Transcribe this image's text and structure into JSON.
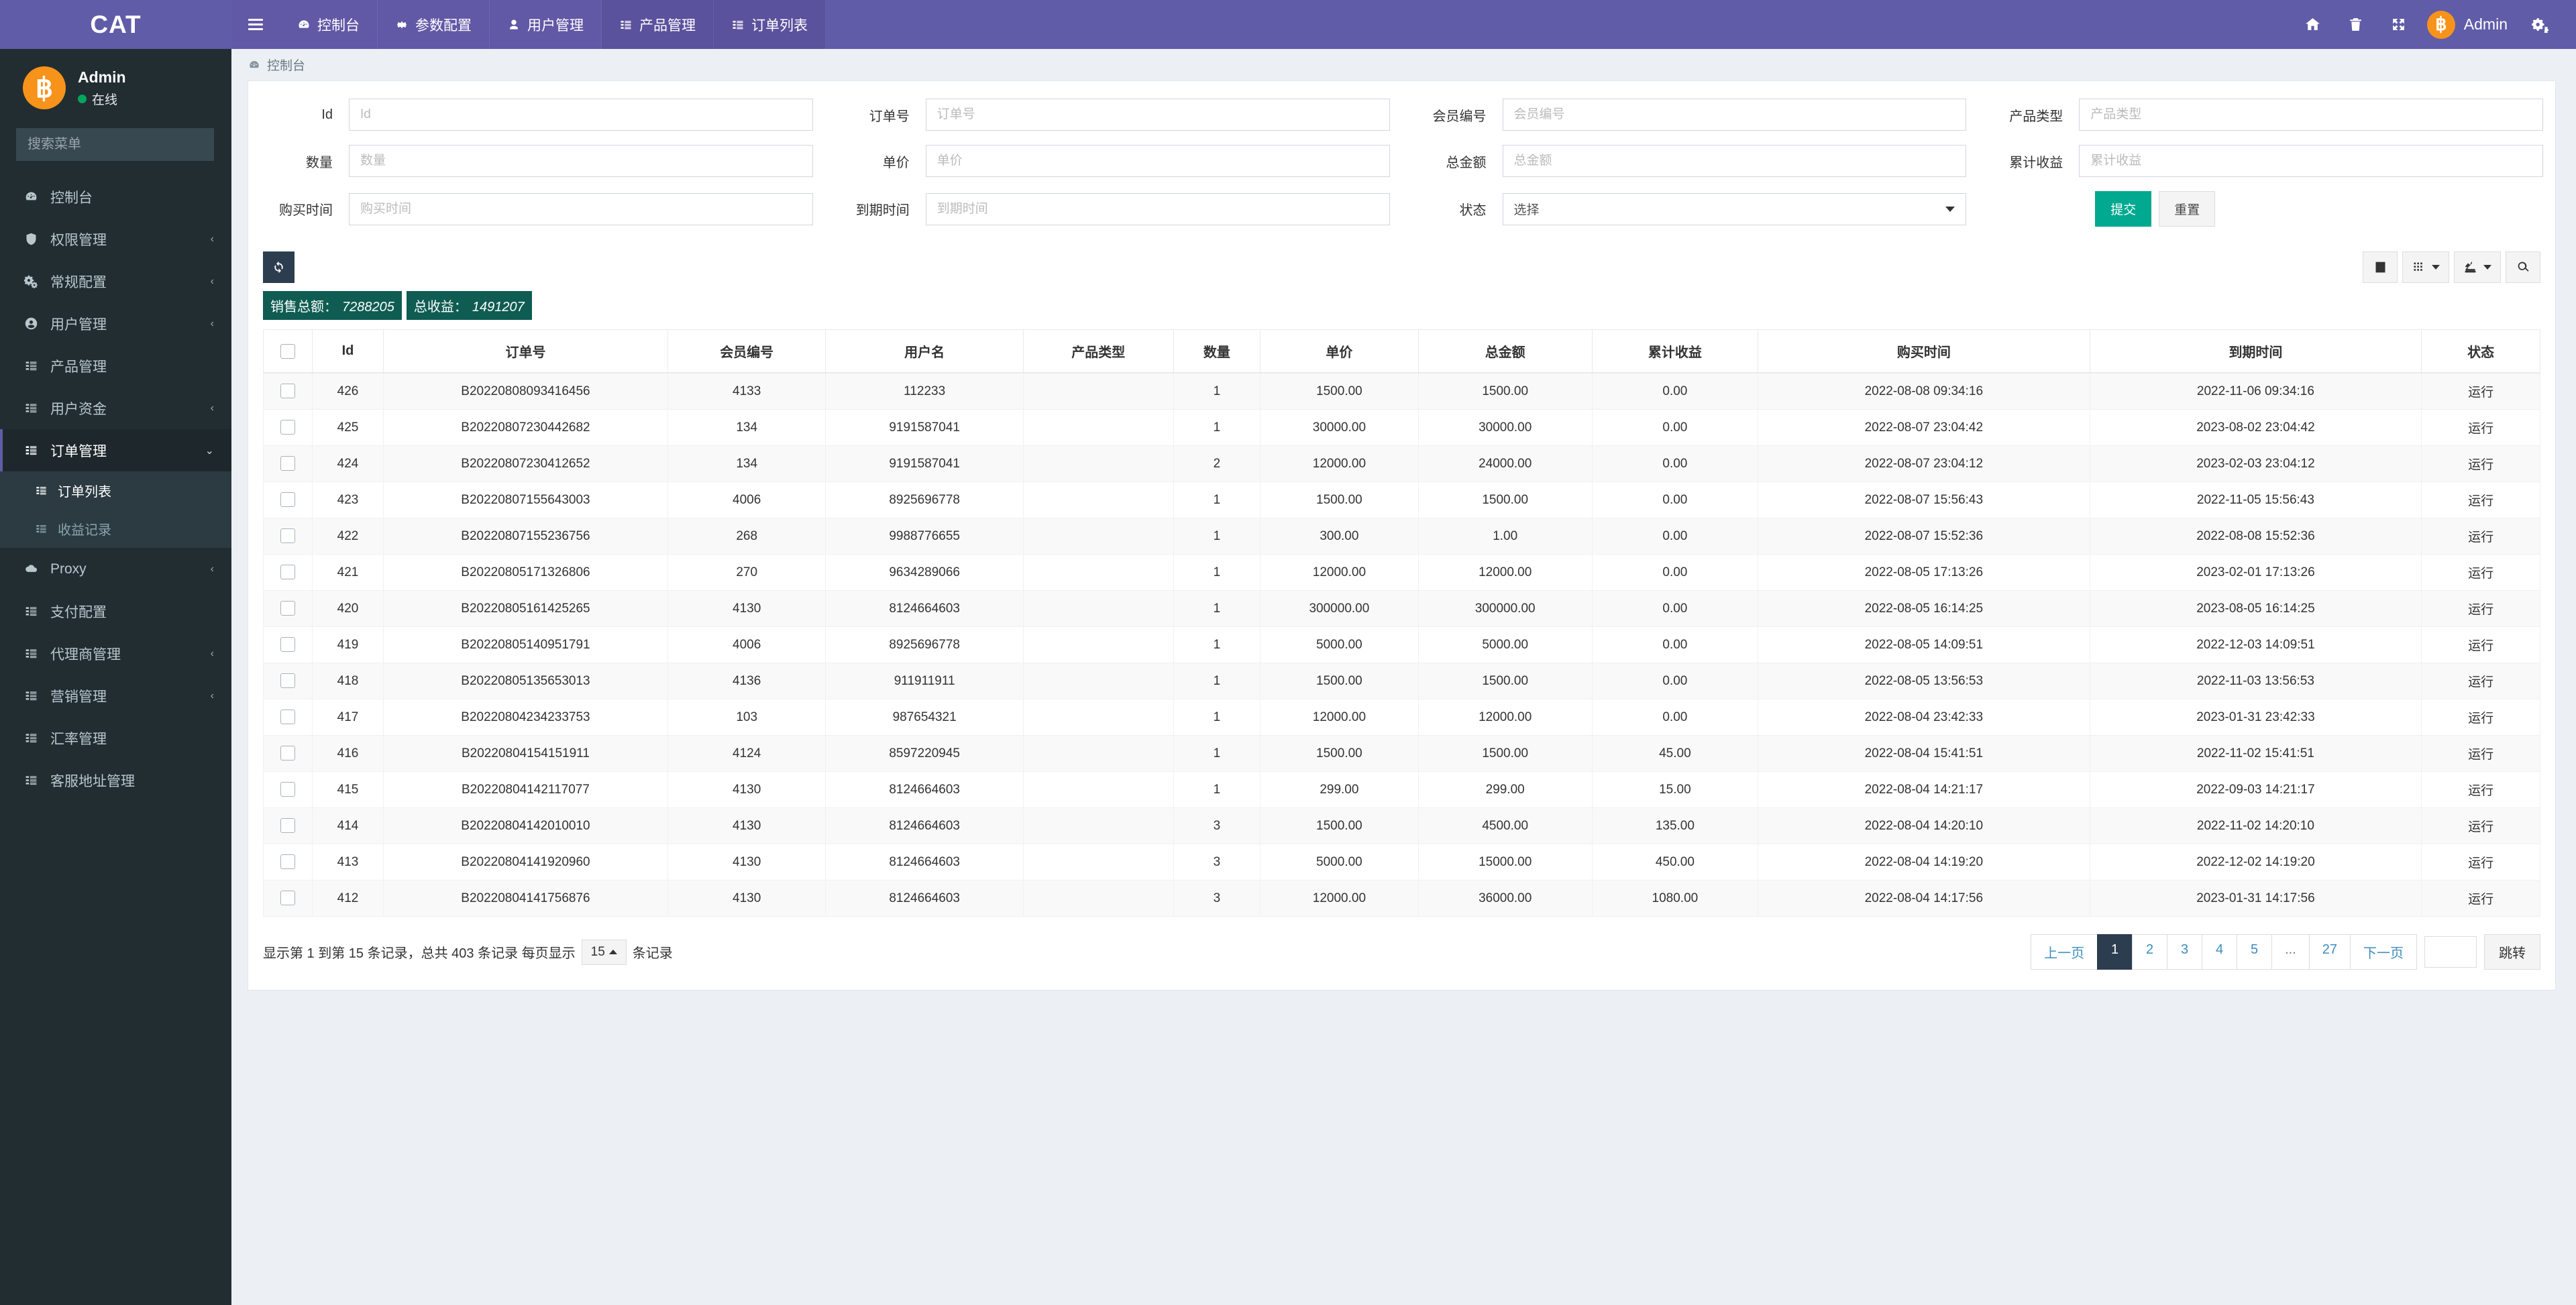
{
  "app": {
    "brand": "CAT",
    "accent_purple": "#605ca8",
    "sidebar_bg": "#222d32",
    "success_green": "#00a98f",
    "stat_bg": "#0f5c52",
    "bitcoin_orange": "#f7931a"
  },
  "topnav": {
    "tabs": [
      {
        "label": "控制台",
        "icon": "dashboard-icon",
        "active": false
      },
      {
        "label": "参数配置",
        "icon": "gear-icon",
        "active": false
      },
      {
        "label": "用户管理",
        "icon": "user-icon",
        "active": false
      },
      {
        "label": "产品管理",
        "icon": "list-icon",
        "active": true
      },
      {
        "label": "订单列表",
        "icon": "list-icon",
        "active": true
      }
    ],
    "right_icons": [
      "home-icon",
      "trash-icon",
      "fullscreen-icon",
      "gears-icon"
    ],
    "user": "Admin"
  },
  "sidebar": {
    "profile": {
      "name": "Admin",
      "status": "在线",
      "avatar": "bitcoin-icon"
    },
    "search_placeholder": "搜索菜单",
    "items": [
      {
        "label": "控制台",
        "icon": "dashboard-icon",
        "arrow": ""
      },
      {
        "label": "权限管理",
        "icon": "shield-icon",
        "arrow": "‹"
      },
      {
        "label": "常规配置",
        "icon": "gears-icon",
        "arrow": "‹"
      },
      {
        "label": "用户管理",
        "icon": "user-circle-icon",
        "arrow": "‹"
      },
      {
        "label": "产品管理",
        "icon": "list-icon",
        "arrow": ""
      },
      {
        "label": "用户资金",
        "icon": "list-icon",
        "arrow": "‹"
      },
      {
        "label": "订单管理",
        "icon": "list-icon",
        "arrow": "⌄",
        "open": true,
        "children": [
          {
            "label": "订单列表",
            "icon": "list-icon",
            "active": true
          },
          {
            "label": "收益记录",
            "icon": "list-icon",
            "active": false
          }
        ]
      },
      {
        "label": "Proxy",
        "icon": "cloud-icon",
        "arrow": "‹"
      },
      {
        "label": "支付配置",
        "icon": "list-icon",
        "arrow": ""
      },
      {
        "label": "代理商管理",
        "icon": "list-icon",
        "arrow": "‹"
      },
      {
        "label": "营销管理",
        "icon": "list-icon",
        "arrow": "‹"
      },
      {
        "label": "汇率管理",
        "icon": "list-icon",
        "arrow": ""
      },
      {
        "label": "客服地址管理",
        "icon": "list-icon",
        "arrow": ""
      }
    ]
  },
  "breadcrumb": {
    "icon": "dashboard-icon",
    "label": "控制台"
  },
  "search_form": {
    "fields": [
      {
        "label": "Id",
        "placeholder": "Id",
        "value": "",
        "type": "text"
      },
      {
        "label": "订单号",
        "placeholder": "订单号",
        "value": "",
        "type": "text"
      },
      {
        "label": "会员编号",
        "placeholder": "会员编号",
        "value": "",
        "type": "text"
      },
      {
        "label": "产品类型",
        "placeholder": "产品类型",
        "value": "",
        "type": "text"
      },
      {
        "label": "数量",
        "placeholder": "数量",
        "value": "",
        "type": "text"
      },
      {
        "label": "单价",
        "placeholder": "单价",
        "value": "",
        "type": "text"
      },
      {
        "label": "总金额",
        "placeholder": "总金额",
        "value": "",
        "type": "text"
      },
      {
        "label": "累计收益",
        "placeholder": "累计收益",
        "value": "",
        "type": "text"
      },
      {
        "label": "购买时间",
        "placeholder": "购买时间",
        "value": "",
        "type": "text"
      },
      {
        "label": "到期时间",
        "placeholder": "到期时间",
        "value": "",
        "type": "text"
      },
      {
        "label": "状态",
        "placeholder": "选择",
        "value": "选择",
        "type": "select"
      }
    ],
    "submit_label": "提交",
    "reset_label": "重置"
  },
  "toolbar": {
    "refresh_icon": "refresh-icon",
    "stats": [
      {
        "label": "销售总额：",
        "value": "7288205"
      },
      {
        "label": "总收益：",
        "value": "1491207"
      }
    ],
    "right_buttons": [
      {
        "icon": "table-view-icon",
        "caret": false
      },
      {
        "icon": "grid-columns-icon",
        "caret": true
      },
      {
        "icon": "export-icon",
        "caret": true
      },
      {
        "icon": "search-icon",
        "caret": false
      }
    ]
  },
  "table": {
    "columns": [
      "Id",
      "订单号",
      "会员编号",
      "用户名",
      "产品类型",
      "数量",
      "单价",
      "总金额",
      "累计收益",
      "购买时间",
      "到期时间",
      "状态"
    ],
    "rows": [
      {
        "id": "426",
        "order_no": "B20220808093416456",
        "member_no": "4133",
        "username": "112233",
        "product_type": "",
        "qty": "1",
        "price": "1500.00",
        "total": "1500.00",
        "profit": "0.00",
        "buy_time": "2022-08-08 09:34:16",
        "expire_time": "2022-11-06 09:34:16",
        "status": "运行"
      },
      {
        "id": "425",
        "order_no": "B20220807230442682",
        "member_no": "134",
        "username": "9191587041",
        "product_type": "",
        "qty": "1",
        "price": "30000.00",
        "total": "30000.00",
        "profit": "0.00",
        "buy_time": "2022-08-07 23:04:42",
        "expire_time": "2023-08-02 23:04:42",
        "status": "运行"
      },
      {
        "id": "424",
        "order_no": "B20220807230412652",
        "member_no": "134",
        "username": "9191587041",
        "product_type": "",
        "qty": "2",
        "price": "12000.00",
        "total": "24000.00",
        "profit": "0.00",
        "buy_time": "2022-08-07 23:04:12",
        "expire_time": "2023-02-03 23:04:12",
        "status": "运行"
      },
      {
        "id": "423",
        "order_no": "B20220807155643003",
        "member_no": "4006",
        "username": "8925696778",
        "product_type": "",
        "qty": "1",
        "price": "1500.00",
        "total": "1500.00",
        "profit": "0.00",
        "buy_time": "2022-08-07 15:56:43",
        "expire_time": "2022-11-05 15:56:43",
        "status": "运行"
      },
      {
        "id": "422",
        "order_no": "B20220807155236756",
        "member_no": "268",
        "username": "9988776655",
        "product_type": "",
        "qty": "1",
        "price": "300.00",
        "total": "1.00",
        "profit": "0.00",
        "buy_time": "2022-08-07 15:52:36",
        "expire_time": "2022-08-08 15:52:36",
        "status": "运行"
      },
      {
        "id": "421",
        "order_no": "B20220805171326806",
        "member_no": "270",
        "username": "9634289066",
        "product_type": "",
        "qty": "1",
        "price": "12000.00",
        "total": "12000.00",
        "profit": "0.00",
        "buy_time": "2022-08-05 17:13:26",
        "expire_time": "2023-02-01 17:13:26",
        "status": "运行"
      },
      {
        "id": "420",
        "order_no": "B20220805161425265",
        "member_no": "4130",
        "username": "8124664603",
        "product_type": "",
        "qty": "1",
        "price": "300000.00",
        "total": "300000.00",
        "profit": "0.00",
        "buy_time": "2022-08-05 16:14:25",
        "expire_time": "2023-08-05 16:14:25",
        "status": "运行"
      },
      {
        "id": "419",
        "order_no": "B20220805140951791",
        "member_no": "4006",
        "username": "8925696778",
        "product_type": "",
        "qty": "1",
        "price": "5000.00",
        "total": "5000.00",
        "profit": "0.00",
        "buy_time": "2022-08-05 14:09:51",
        "expire_time": "2022-12-03 14:09:51",
        "status": "运行"
      },
      {
        "id": "418",
        "order_no": "B20220805135653013",
        "member_no": "4136",
        "username": "911911911",
        "product_type": "",
        "qty": "1",
        "price": "1500.00",
        "total": "1500.00",
        "profit": "0.00",
        "buy_time": "2022-08-05 13:56:53",
        "expire_time": "2022-11-03 13:56:53",
        "status": "运行"
      },
      {
        "id": "417",
        "order_no": "B20220804234233753",
        "member_no": "103",
        "username": "987654321",
        "product_type": "",
        "qty": "1",
        "price": "12000.00",
        "total": "12000.00",
        "profit": "0.00",
        "buy_time": "2022-08-04 23:42:33",
        "expire_time": "2023-01-31 23:42:33",
        "status": "运行"
      },
      {
        "id": "416",
        "order_no": "B20220804154151911",
        "member_no": "4124",
        "username": "8597220945",
        "product_type": "",
        "qty": "1",
        "price": "1500.00",
        "total": "1500.00",
        "profit": "45.00",
        "buy_time": "2022-08-04 15:41:51",
        "expire_time": "2022-11-02 15:41:51",
        "status": "运行"
      },
      {
        "id": "415",
        "order_no": "B20220804142117077",
        "member_no": "4130",
        "username": "8124664603",
        "product_type": "",
        "qty": "1",
        "price": "299.00",
        "total": "299.00",
        "profit": "15.00",
        "buy_time": "2022-08-04 14:21:17",
        "expire_time": "2022-09-03 14:21:17",
        "status": "运行"
      },
      {
        "id": "414",
        "order_no": "B20220804142010010",
        "member_no": "4130",
        "username": "8124664603",
        "product_type": "",
        "qty": "3",
        "price": "1500.00",
        "total": "4500.00",
        "profit": "135.00",
        "buy_time": "2022-08-04 14:20:10",
        "expire_time": "2022-11-02 14:20:10",
        "status": "运行"
      },
      {
        "id": "413",
        "order_no": "B20220804141920960",
        "member_no": "4130",
        "username": "8124664603",
        "product_type": "",
        "qty": "3",
        "price": "5000.00",
        "total": "15000.00",
        "profit": "450.00",
        "buy_time": "2022-08-04 14:19:20",
        "expire_time": "2022-12-02 14:19:20",
        "status": "运行"
      },
      {
        "id": "412",
        "order_no": "B20220804141756876",
        "member_no": "4130",
        "username": "8124664603",
        "product_type": "",
        "qty": "3",
        "price": "12000.00",
        "total": "36000.00",
        "profit": "1080.00",
        "buy_time": "2022-08-04 14:17:56",
        "expire_time": "2023-01-31 14:17:56",
        "status": "运行"
      }
    ]
  },
  "pagination": {
    "info_prefix": "显示第 1 到第 15 条记录，总共 403 条记录 每页显示",
    "page_size": "15",
    "info_suffix": "条记录",
    "prev_label": "上一页",
    "next_label": "下一页",
    "pages": [
      "1",
      "2",
      "3",
      "4",
      "5",
      "...",
      "27"
    ],
    "current_page": "1",
    "jump_value": "",
    "jump_label": "跳转"
  }
}
